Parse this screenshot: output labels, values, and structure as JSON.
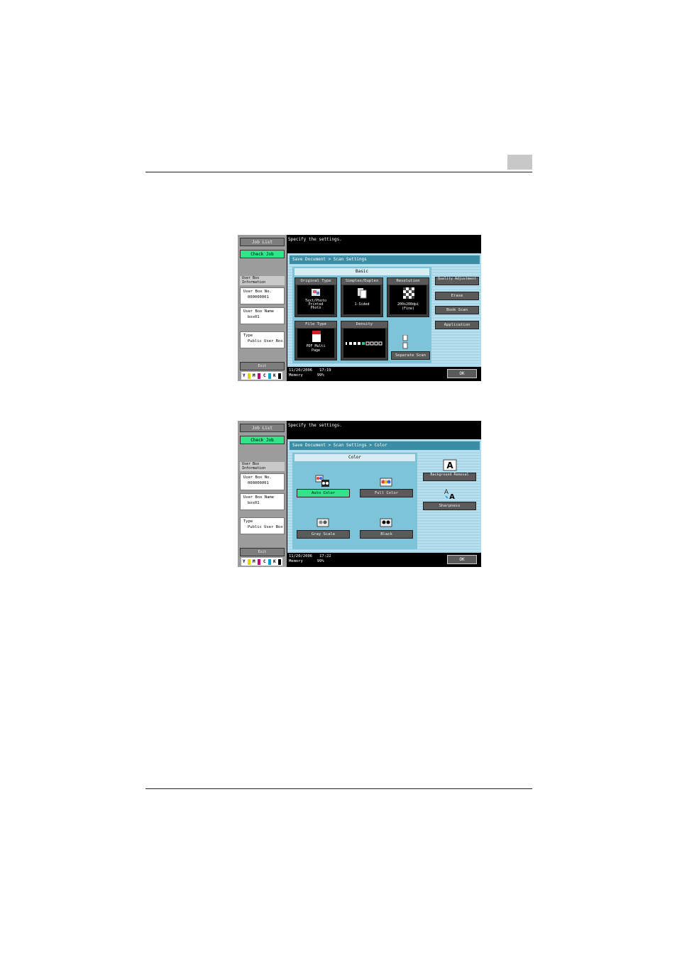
{
  "screen1": {
    "left": {
      "job_list": "Job List",
      "check_job": "Check Job",
      "user_box_info": "User Box Information",
      "box_no_label": "User Box No.",
      "box_no": "000000001",
      "box_name_label": "User Box Name",
      "box_name": "box01",
      "type_label": "Type",
      "type_value": "Public User Box",
      "exit": "Exit",
      "toner": [
        "Y",
        "M",
        "C",
        "K"
      ]
    },
    "message": "Specify the settings.",
    "breadcrumb": "Save Document > Scan Settings",
    "group_title": "Basic",
    "tiles": [
      {
        "title": "Original Type",
        "value": "Text/Photo Printed Photo"
      },
      {
        "title": "Simplex/Duplex",
        "value": "1-Sided"
      },
      {
        "title": "Resolution",
        "value": "200x200dpi (Fine)"
      },
      {
        "title": "File Type",
        "value": "PDF Multi Page"
      },
      {
        "title": "Density",
        "value": ""
      }
    ],
    "separate_scan": "Separate Scan",
    "right_buttons": [
      "Quality Adjustment",
      "Erase",
      "Book Scan",
      "Application"
    ],
    "status_date": "11/20/2006",
    "status_time": "17:19",
    "memory_label": "Memory",
    "memory_value": "99%",
    "ok": "OK"
  },
  "screen2": {
    "left": {
      "job_list": "Job List",
      "check_job": "Check Job",
      "user_box_info": "User Box Information",
      "box_no_label": "User Box No.",
      "box_no": "000000001",
      "box_name_label": "User Box Name",
      "box_name": "box01",
      "type_label": "Type",
      "type_value": "Public User Box",
      "exit": "Exit",
      "toner": [
        "Y",
        "M",
        "C",
        "K"
      ]
    },
    "message": "Specify the settings.",
    "breadcrumb": "Save Document > Scan Settings > Color",
    "group_title": "Color",
    "options": [
      "Auto Color",
      "Full Color",
      "Gray Scale",
      "Black"
    ],
    "selected": "Auto Color",
    "right_buttons": [
      "Background Removal",
      "Sharpness"
    ],
    "status_date": "11/20/2006",
    "status_time": "17:22",
    "memory_label": "Memory",
    "memory_value": "99%",
    "ok": "OK"
  }
}
